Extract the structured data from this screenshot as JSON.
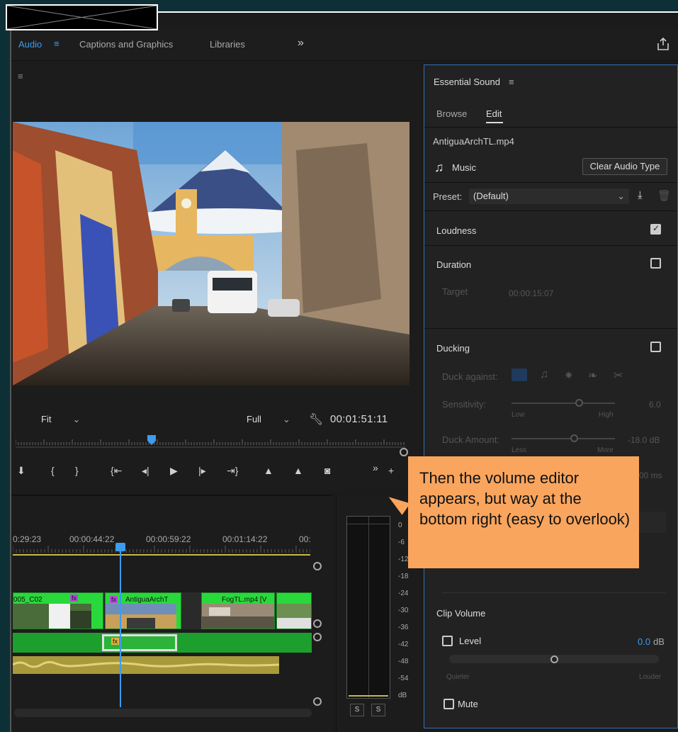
{
  "workspaces": {
    "tabs": [
      "Audio",
      "Captions and Graphics",
      "Libraries"
    ],
    "more": "»"
  },
  "monitor": {
    "zoom": "Fit",
    "resolution": "Full",
    "timecode": "00:01:51:11"
  },
  "timeline": {
    "timecodes": [
      "0:29:23",
      "00:00:44:22",
      "00:00:59:22",
      "00:01:14:22",
      "00:"
    ],
    "clips": [
      "005_C02",
      "AntiguaArchT",
      "FogTL.mp4 [V"
    ],
    "fx_badge": "fx"
  },
  "meters": {
    "scale": [
      "0",
      "-6",
      "-12",
      "-18",
      "-24",
      "-30",
      "-36",
      "-42",
      "-48",
      "-54",
      "dB"
    ],
    "solo_labels": [
      "S",
      "S"
    ]
  },
  "essential_sound": {
    "title": "Essential Sound",
    "tabs": [
      "Browse",
      "Edit"
    ],
    "active_tab": "Edit",
    "clip_name": "AntiguaArchTL.mp4",
    "audio_type": "Music",
    "clear_button": "Clear Audio Type",
    "preset_label": "Preset:",
    "preset_value": "(Default)",
    "loudness": {
      "label": "Loudness",
      "checked": true
    },
    "duration": {
      "label": "Duration",
      "checked": false,
      "target_label": "Target",
      "target_value": "00:00:15:07"
    },
    "ducking": {
      "label": "Ducking",
      "checked": false,
      "duck_against": "Duck against:",
      "sensitivity": {
        "label": "Sensitivity:",
        "min": "Low",
        "max": "High",
        "value": "6.0",
        "level": 0.65
      },
      "duck_amount": {
        "label": "Duck Amount:",
        "min": "Less",
        "max": "More",
        "value": "-18.0 dB",
        "level": 0.6
      },
      "partial_value": "00 ms"
    },
    "clip_volume": {
      "label": "Clip Volume",
      "level_label": "Level",
      "level_value": "0.0",
      "level_unit": "dB",
      "min": "Quieter",
      "max": "Louder",
      "level": 0.5,
      "mute_label": "Mute"
    }
  },
  "callout": {
    "text": "Then the volume editor appears, but way at the bottom right (easy to overlook)"
  },
  "colors": {
    "accent": "#3d9bf0",
    "callout": "#f9a55e",
    "clip_green": "#29d93b"
  }
}
